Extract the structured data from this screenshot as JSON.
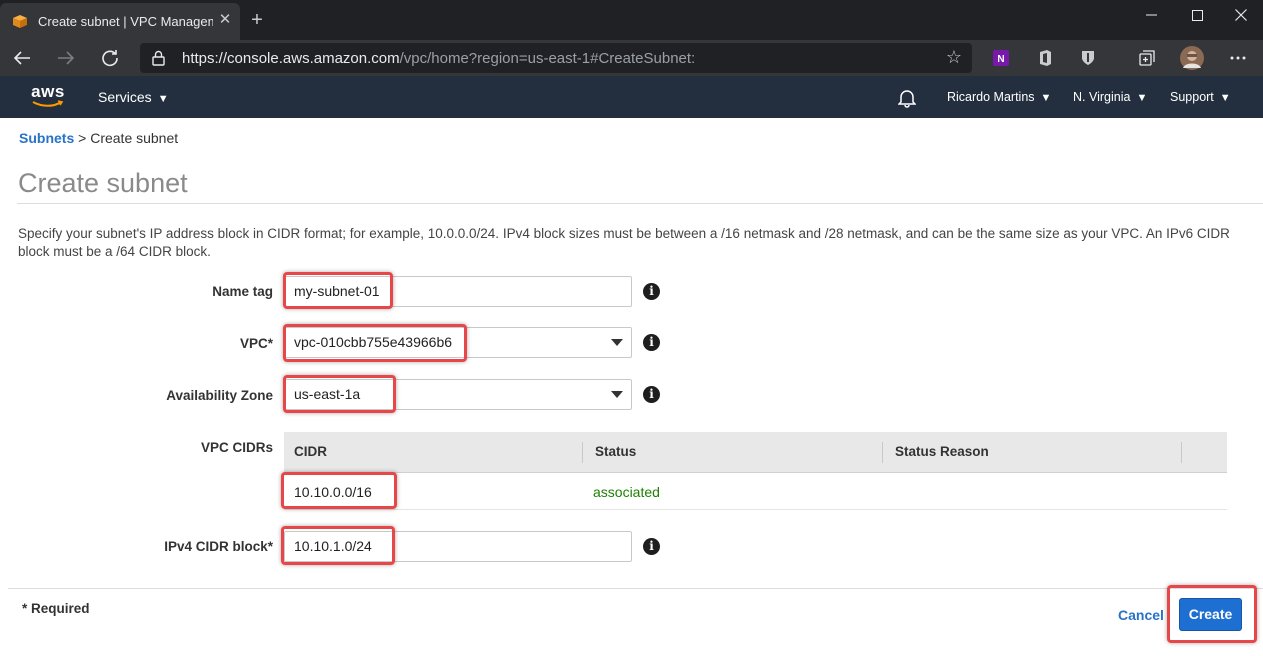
{
  "browser": {
    "tab_title": "Create subnet | VPC Management Console",
    "url_host": "https://console.aws.amazon.com",
    "url_path": "/vpc/home?region=us-east-1#CreateSubnet:"
  },
  "aws_nav": {
    "logo": "aws",
    "services": "Services",
    "user": "Ricardo Martins",
    "region": "N. Virginia",
    "support": "Support"
  },
  "breadcrumb": {
    "parent": "Subnets",
    "separator": ">",
    "current": "Create subnet"
  },
  "page": {
    "title": "Create subnet",
    "description": "Specify your subnet's IP address block in CIDR format; for example, 10.0.0.0/24. IPv4 block sizes must be between a /16 netmask and /28 netmask, and can be the same size as your VPC. An IPv6 CIDR block must be a /64 CIDR block."
  },
  "form": {
    "name_tag": {
      "label": "Name tag",
      "value": "my-subnet-01"
    },
    "vpc": {
      "label": "VPC*",
      "value": "vpc-010cbb755e43966b6"
    },
    "availability_zone": {
      "label": "Availability Zone",
      "value": "us-east-1a"
    },
    "vpc_cidrs": {
      "label": "VPC CIDRs",
      "columns": [
        "CIDR",
        "Status",
        "Status Reason"
      ],
      "rows": [
        {
          "cidr": "10.10.0.0/16",
          "status": "associated",
          "reason": ""
        }
      ]
    },
    "ipv4_cidr": {
      "label": "IPv4 CIDR block*",
      "value": "10.10.1.0/24"
    }
  },
  "footer": {
    "required_note": "* Required",
    "cancel": "Cancel",
    "create": "Create"
  },
  "colors": {
    "aws_nav_bg": "#232f3e",
    "link_blue": "#2873c6",
    "create_button": "#1d6fd1",
    "status_ok": "#1d8102",
    "highlight": "#e8474a"
  }
}
